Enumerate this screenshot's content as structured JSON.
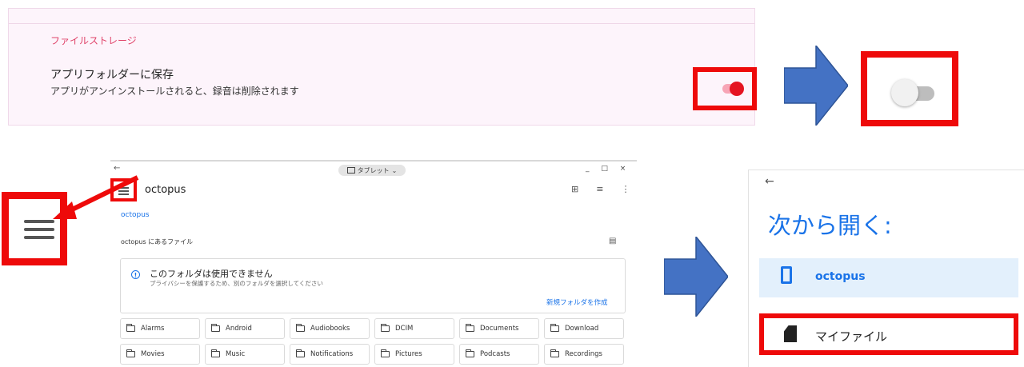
{
  "settings": {
    "section_heading": "ファイルストレージ",
    "title": "アプリフォルダーに保存",
    "description": "アプリがアンインストールされると、録音は削除されます",
    "toggle_on_state": "on",
    "toggle_off_state": "off",
    "accent_color": "#e51421"
  },
  "tablet": {
    "back_glyph": "←",
    "mode_chip": "タブレット",
    "window_controls": "_ □ ×",
    "title": "octopus",
    "breadcrumb": "octopus",
    "files_label": "octopus にあるファイル",
    "warning": {
      "title": "このフォルダは使用できません",
      "description": "プライバシーを保護するため、別のフォルダを選択してください",
      "action": "新規フォルダを作成"
    },
    "folders": [
      "Alarms",
      "Android",
      "Audiobooks",
      "DCIM",
      "Documents",
      "Download",
      "Movies",
      "Music",
      "Notifications",
      "Pictures",
      "Podcasts",
      "Recordings"
    ]
  },
  "open_from": {
    "back_glyph": "←",
    "title": "次から開く:",
    "items": [
      {
        "label": "octopus",
        "icon": "phone-icon",
        "selected": true
      },
      {
        "label": "マイファイル",
        "icon": "sd-card-icon",
        "selected": false
      }
    ],
    "link_color": "#1a73e8"
  },
  "highlight_color": "#ee0a0a",
  "arrow_color": "#4472c4"
}
